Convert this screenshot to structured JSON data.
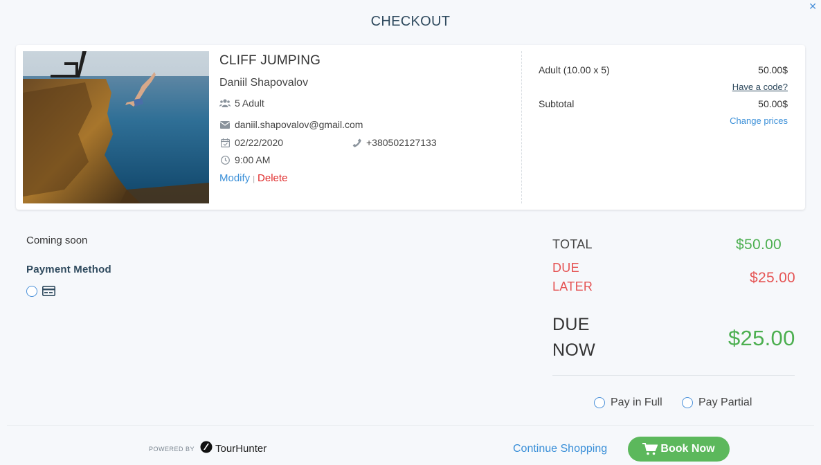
{
  "page": {
    "title": "CHECKOUT",
    "close_icon": "close-icon"
  },
  "booking": {
    "tour_name": "CLIFF JUMPING",
    "customer_name": "Daniil Shapovalov",
    "participants": "5 Adult",
    "email": "daniil.shapovalov@gmail.com",
    "date": "02/22/2020",
    "phone": "+380502127133",
    "time": "9:00 AM",
    "modify_label": "Modify",
    "separator": "|",
    "delete_label": "Delete"
  },
  "pricing": {
    "line_label": "Adult (10.00 x 5)",
    "line_value": "50.00$",
    "have_code_label": "Have a code?",
    "subtotal_label": "Subtotal",
    "subtotal_value": "50.00$",
    "change_prices_label": "Change prices"
  },
  "payment": {
    "coming_soon": "Coming soon",
    "method_label": "Payment Method"
  },
  "totals": {
    "total_label": "TOTAL",
    "total_value": "$50.00",
    "due_later_label_1": "DUE",
    "due_later_label_2": "LATER",
    "due_later_value": "$25.00",
    "due_now_label_1": "DUE",
    "due_now_label_2": "NOW",
    "due_now_value": "$25.00",
    "pay_full_label": "Pay in Full",
    "pay_partial_label": "Pay Partial"
  },
  "footer": {
    "powered_by": "POWERED BY",
    "brand_name": "TourHunter",
    "continue_label": "Continue Shopping",
    "book_label": "Book Now"
  },
  "colors": {
    "accent_blue": "#3a8fd8",
    "delete_red": "#e02b2b",
    "total_green": "#4caf50",
    "due_red": "#e55353",
    "book_button": "#5cb85c"
  }
}
